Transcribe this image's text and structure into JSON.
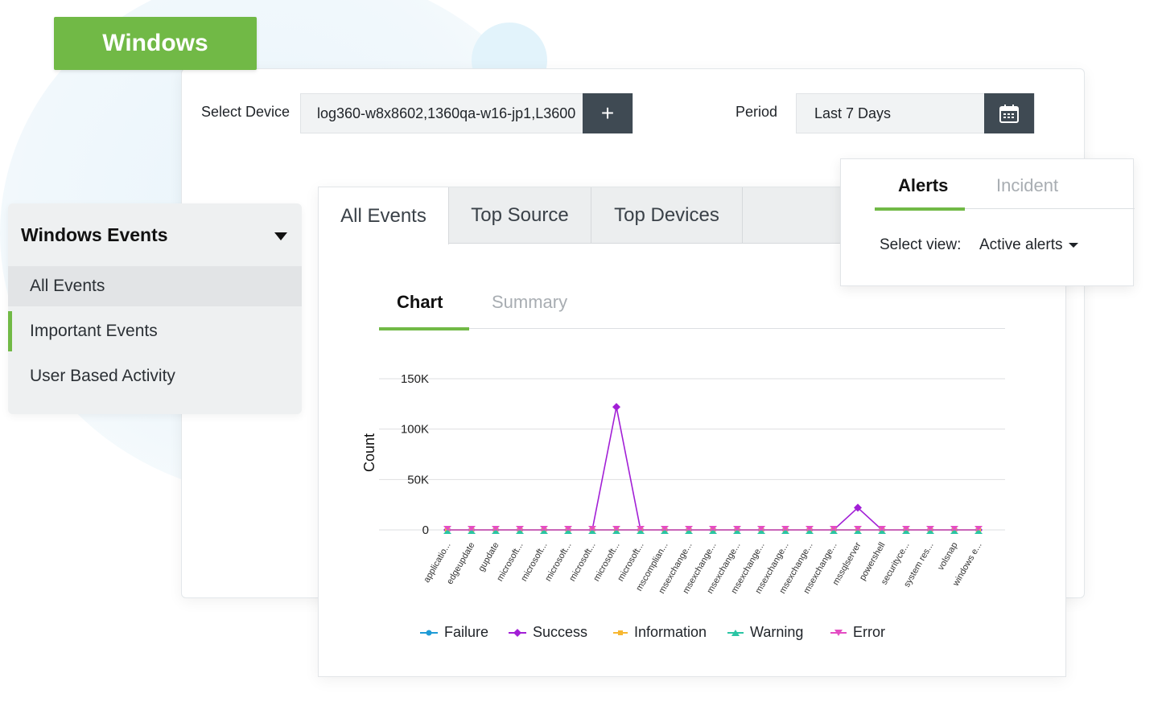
{
  "badge": {
    "title": "Windows"
  },
  "header": {
    "device_label": "Select Device",
    "device_value": "log360-w8x8602,1360qa-w16-jp1,L3600",
    "add_glyph": "+",
    "period_label": "Period",
    "period_value": "Last 7 Days"
  },
  "sidebar": {
    "heading": "Windows Events",
    "items": [
      {
        "label": "All Events"
      },
      {
        "label": "Important Events"
      },
      {
        "label": "User Based Activity"
      }
    ]
  },
  "tabs": [
    {
      "label": "All Events"
    },
    {
      "label": "Top Source"
    },
    {
      "label": "Top Devices"
    }
  ],
  "subtabs": [
    {
      "label": "Chart"
    },
    {
      "label": "Summary"
    }
  ],
  "alerts_panel": {
    "tabs": [
      {
        "label": "Alerts"
      },
      {
        "label": "Incident"
      }
    ],
    "select_label": "Select view:",
    "select_value": "Active alerts"
  },
  "colors": {
    "brand_green": "#71b946",
    "dark_button": "#3f4a53",
    "failure": "#1f9bd6",
    "success": "#a21fd6",
    "information": "#f7b731",
    "warning": "#2bc5a4",
    "error": "#e44dc3"
  },
  "icons": [
    "plus-icon",
    "calendar-icon",
    "caret-down-icon"
  ],
  "chart_data": {
    "type": "line",
    "ylabel": "Count",
    "xlabel": "",
    "ylim": [
      0,
      150000
    ],
    "y_ticks": [
      "0",
      "50K",
      "100K",
      "150K"
    ],
    "grid": true,
    "legend_position": "bottom",
    "categories": [
      "applicatio...",
      "edgeupdate",
      "gupdate",
      "microsoft...",
      "microsoft...",
      "microsoft...",
      "microsoft...",
      "microsoft...",
      "microsoft...",
      "mscomplian...",
      "msexchange...",
      "msexchange...",
      "msexchange...",
      "msexchange...",
      "msexchange...",
      "msexchange...",
      "msexchange...",
      "mssqlserver",
      "powershell",
      "securityce...",
      "system res...",
      "volsnap",
      "windows e..."
    ],
    "series": [
      {
        "name": "Failure",
        "values": [
          0,
          0,
          0,
          0,
          0,
          0,
          0,
          0,
          0,
          0,
          0,
          0,
          0,
          0,
          0,
          0,
          0,
          0,
          0,
          0,
          0,
          0,
          0
        ]
      },
      {
        "name": "Success",
        "values": [
          0,
          0,
          0,
          0,
          0,
          0,
          0,
          122000,
          0,
          0,
          0,
          0,
          0,
          0,
          0,
          0,
          0,
          22000,
          0,
          0,
          0,
          0,
          0
        ]
      },
      {
        "name": "Information",
        "values": [
          0,
          0,
          0,
          0,
          0,
          0,
          0,
          0,
          0,
          0,
          0,
          0,
          0,
          0,
          0,
          0,
          0,
          0,
          0,
          0,
          0,
          0,
          0
        ]
      },
      {
        "name": "Warning",
        "values": [
          0,
          0,
          0,
          0,
          0,
          0,
          0,
          0,
          0,
          0,
          0,
          0,
          0,
          0,
          0,
          0,
          0,
          0,
          0,
          0,
          0,
          0,
          0
        ]
      },
      {
        "name": "Error",
        "values": [
          0,
          0,
          0,
          0,
          0,
          0,
          0,
          0,
          0,
          0,
          0,
          0,
          0,
          0,
          0,
          0,
          0,
          0,
          0,
          0,
          0,
          0,
          0
        ]
      }
    ]
  }
}
